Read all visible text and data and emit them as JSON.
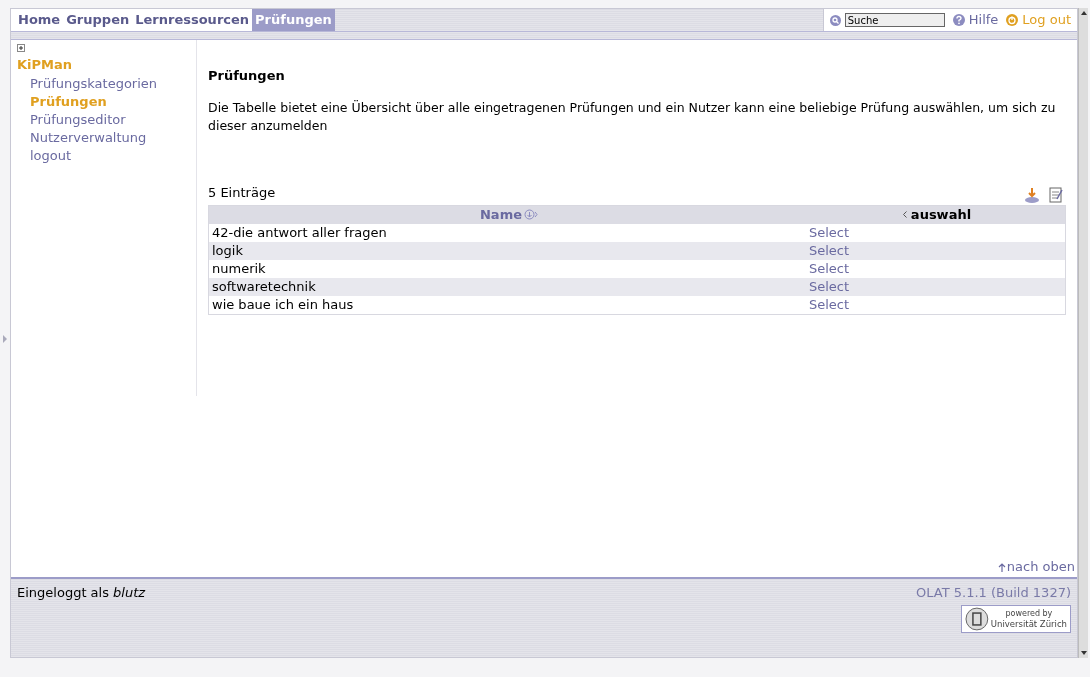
{
  "top_nav": {
    "tabs": [
      {
        "label": "Home",
        "selected": false
      },
      {
        "label": "Gruppen",
        "selected": false
      },
      {
        "label": "Lernressourcen",
        "selected": false
      },
      {
        "label": "Prüfungen",
        "selected": true
      }
    ],
    "search": {
      "value": "Suche"
    },
    "help": "Hilfe",
    "logout": "Log out"
  },
  "sidebar": {
    "title": "KiPMan",
    "items": [
      {
        "label": "Prüfungskategorien",
        "selected": false
      },
      {
        "label": "Prüfungen",
        "selected": true
      },
      {
        "label": "Prüfungseditor",
        "selected": false
      },
      {
        "label": "Nutzerverwaltung",
        "selected": false
      },
      {
        "label": "logout",
        "selected": false
      }
    ]
  },
  "content": {
    "heading": "Prüfungen",
    "description": "Die Tabelle bietet eine Übersicht über alle eingetragenen Prüfungen und ein Nutzer kann eine beliebige Prüfung auswählen, um sich zu dieser anzumelden",
    "count": "5 Einträge",
    "table": {
      "columns": [
        {
          "label": "Name",
          "kind": "sortable"
        },
        {
          "label": "auswahl",
          "kind": "sorted"
        }
      ],
      "rows": [
        {
          "name": "42-die antwort aller fragen",
          "action": "Select"
        },
        {
          "name": "logik",
          "action": "Select"
        },
        {
          "name": "numerik",
          "action": "Select"
        },
        {
          "name": "softwaretechnik",
          "action": "Select"
        },
        {
          "name": "wie baue ich ein haus",
          "action": "Select"
        }
      ]
    },
    "back_to_top": "nach oben"
  },
  "footer": {
    "login_text": "Eingeloggt als *blutz*",
    "version": "OLAT 5.1.1 (Build 1327)",
    "badge_lines": [
      "powered by",
      "Universität Zürich"
    ]
  }
}
